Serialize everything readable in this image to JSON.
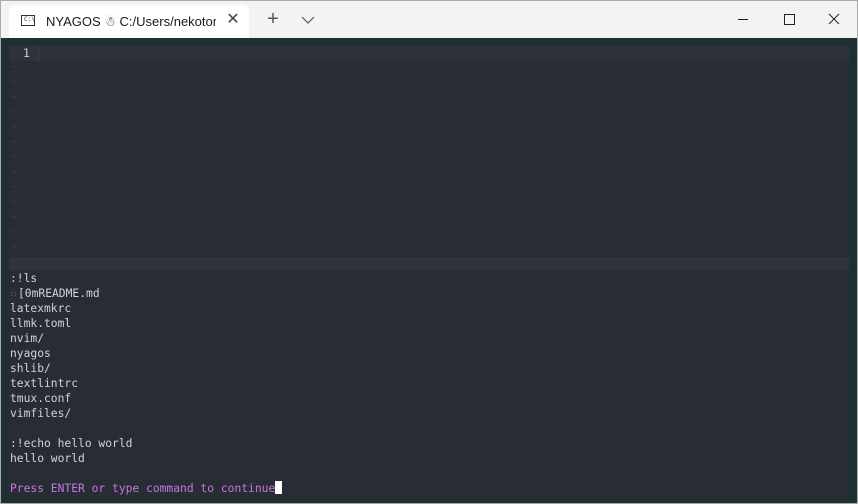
{
  "tab": {
    "icon": "terminal-icon",
    "title": "NYAGOS ☃ C:/Users/nekotoma"
  },
  "titlebar": {
    "close_tab_glyph": "✕",
    "new_tab_glyph": "+"
  },
  "editor": {
    "line_number": "1",
    "tilde": "~"
  },
  "output": [
    {
      ":!ls": true
    },
    {
      "line": ":!ls"
    },
    {
      "line": "[0mREADME.md",
      "escape": true
    },
    {
      "line": "latexmkrc"
    },
    {
      "line": "llmk.toml"
    },
    {
      "line": "nvim/"
    },
    {
      "line": "nyagos"
    },
    {
      "line": "shlib/"
    },
    {
      "line": "textlintrc"
    },
    {
      "line": "tmux.conf"
    },
    {
      "line": "vimfiles/"
    },
    {
      "line": ""
    },
    {
      "line": ":!echo hello world"
    },
    {
      "line": "hello world"
    }
  ],
  "lines": {
    "cmd_ls": ":!ls",
    "readme": "[0mREADME.md",
    "latexmkrc": "latexmkrc",
    "llmk": "llmk.toml",
    "nvim": "nvim/",
    "nyagos": "nyagos",
    "shlib": "shlib/",
    "textlintrc": "textlintrc",
    "tmux": "tmux.conf",
    "vimfiles": "vimfiles/",
    "cmd_echo": ":!echo hello world",
    "echo_out": "hello world"
  },
  "prompt": "Press ENTER or type command to continue",
  "colors": {
    "terminal_bg": "#282c34",
    "frame_bg": "#1e3033",
    "prompt_text": "#c678dd",
    "text": "#cfd3da"
  }
}
